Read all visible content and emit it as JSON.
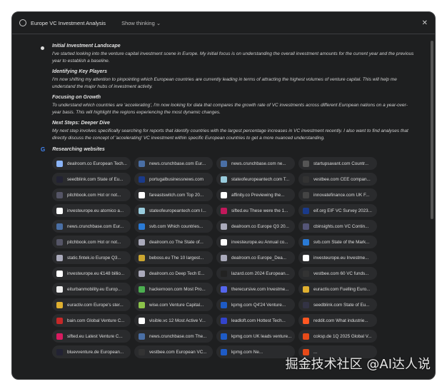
{
  "header": {
    "title": "Europe VC Investment Analysis",
    "show_thinking": "Show thinking",
    "chevron": "⌄",
    "close": "✕"
  },
  "sections": [
    {
      "title": "Initial Investment Landscape",
      "text": "I've started looking into the venture capital investment scene in Europe. My initial focus is on understanding the overall investment amounts for the current year and the previous year to establish a baseline."
    },
    {
      "title": "Identifying Key Players",
      "text": "I'm now shifting my attention to pinpointing which European countries are currently leading in terms of attracting the highest volumes of venture capital. This will help me understand the major hubs of investment activity."
    },
    {
      "title": "Focusing on Growth",
      "text": "To understand which countries are 'accelerating', I'm now looking for data that compares the growth rate of VC investments across different European nations on a year-over-year basis. This will highlight the regions experiencing the most dynamic changes."
    },
    {
      "title": "Next Steps: Deeper Dive",
      "text": "My next step involves specifically searching for reports that identify countries with the largest percentage increases in VC investment recently. I also want to find analyses that directly discuss the concept of 'accelerating' VC investment within specific European countries to get a more nuanced understanding."
    }
  ],
  "researching": {
    "icon": "G",
    "label": "Researching websites"
  },
  "sites": [
    "dealroom.co European Tech...",
    "news.crunchbase.com Eur...",
    "news.crunchbase.com ne...",
    "startupsavant.com Countr...",
    "seedblink.com State of Eu...",
    "portugalbusinessnews.com",
    "stateofeuropeantech.com T...",
    "vestbee.com CEE compan...",
    "pitchbook.com Hot or not...",
    "fareastswitch.com Top 20...",
    "affinity.co Previewing the...",
    "innovatefinance.com UK F...",
    "investeurope.eu atomico a...",
    "stateofeuropeantech.com I...",
    "sifted.eu These were the 1...",
    "eif.org EIF VC Survey 2023...",
    "news.crunchbase.com Eur...",
    "svb.com Which countries...",
    "dealroom.co Europe Q3 20...",
    "cbinsights.com VC Contin...",
    "pitchbook.com Hot or not...",
    "dealroom.co The State of...",
    "investeurope.eu Annual co...",
    "svb.com State of the Mark...",
    "static.fintek.io Europe Q3...",
    "beboss.eu The 10 largest...",
    "dealroom.co Europe_Dea...",
    "investeurope.eu Investme...",
    "investeurope.eu €148 billio...",
    "dealroom.co Deep Tech E...",
    "lazard.com 2024 European...",
    "vestbee.com 60 VC funds...",
    "eiturbanmobility.eu Europ...",
    "hackernoon.com Most Pro...",
    "therecursive.com Investme...",
    "euractiv.com Fuelling Euro...",
    "euractiv.com Europe's ster...",
    "wise.com Venture Capital...",
    "kpmg.com Q4'24 Venture...",
    "seedblink.com State of Eu...",
    "bain.com Global Venture C...",
    "visible.vc 12 Most Active V...",
    "leadloft.com Hottest Tech...",
    "reddit.com What industrie...",
    "sifted.eu Latest Venture C...",
    "news.crunchbase.com The...",
    "kpmg.com UK leads venture...",
    "coksp.de 1Q 2025 Global V...",
    "bluevventure.de European...",
    "vestbee.com European VC...",
    "kpmg.com Ne...",
    "..."
  ],
  "favicon_colors": [
    "#8ab4f8",
    "#4a6fa5",
    "#4a6fa5",
    "#555",
    "#223",
    "#1a3a8a",
    "#9cd",
    "#333",
    "#556",
    "#fff",
    "#fff",
    "#444",
    "#fff",
    "#9cd",
    "#c2185b",
    "#1a3a8a",
    "#4a6fa5",
    "#2a7ad5",
    "#aab",
    "#557",
    "#556",
    "#aab",
    "#fff",
    "#2a7ad5",
    "#aab",
    "#caa530",
    "#aab",
    "#fff",
    "#fff",
    "#aab",
    "#222",
    "#333",
    "#eee",
    "#4caf50",
    "#5566ee",
    "#e0b030",
    "#e0b030",
    "#8bc34a",
    "#1e5bc6",
    "#334",
    "#c62828",
    "#fff",
    "#3344cc",
    "#ff5722",
    "#d81b60",
    "#4a6fa5",
    "#1e5bc6",
    "#e64a19",
    "#223",
    "#333",
    "#1e5bc6",
    "#e64a19"
  ],
  "watermark": "掘金技术社区 @AI达人说"
}
